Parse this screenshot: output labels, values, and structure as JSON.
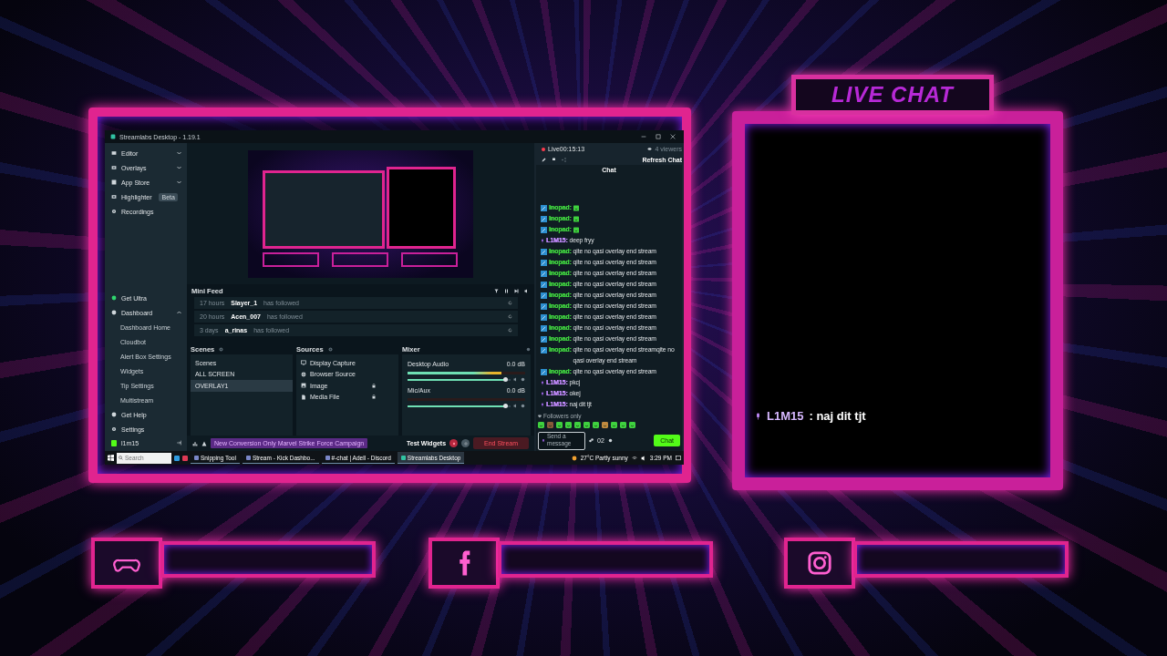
{
  "app_window": {
    "title": "Streamlabs Desktop - 1.19.1",
    "sidebar": {
      "top_items": [
        {
          "label": "Editor",
          "kind": "group",
          "expanded": false
        },
        {
          "label": "Overlays",
          "kind": "group",
          "expanded": false
        },
        {
          "label": "App Store",
          "kind": "group",
          "expanded": false
        },
        {
          "label": "Highlighter",
          "kind": "badge",
          "badge": "Beta"
        },
        {
          "label": "Recordings",
          "kind": "link"
        }
      ],
      "bottom_items": [
        {
          "label": "Get Ultra",
          "kind": "link"
        },
        {
          "label": "Dashboard",
          "kind": "group",
          "expanded": true,
          "children": [
            {
              "label": "Dashboard Home"
            },
            {
              "label": "Cloudbot"
            },
            {
              "label": "Alert Box Settings"
            },
            {
              "label": "Widgets"
            },
            {
              "label": "Tip Settings"
            },
            {
              "label": "Multistream"
            }
          ]
        },
        {
          "label": "Get Help",
          "kind": "link"
        },
        {
          "label": "Settings",
          "kind": "link"
        }
      ],
      "user": "l1m15"
    },
    "mini_feed": {
      "title": "Mini Feed",
      "events": [
        {
          "time": "17 hours",
          "user": "Slayer_1",
          "action": "has followed"
        },
        {
          "time": "20 hours",
          "user": "Acen_007",
          "action": "has followed"
        },
        {
          "time": "3 days",
          "user": "a_rinas",
          "action": "has followed"
        }
      ]
    },
    "scenes": {
      "title": "Scenes",
      "items": [
        {
          "label": "Scenes",
          "selected": false
        },
        {
          "label": "ALL SCREEN",
          "selected": false
        },
        {
          "label": "OVERLAY1",
          "selected": true
        }
      ]
    },
    "sources": {
      "title": "Sources",
      "items": [
        {
          "label": "Display Capture",
          "kind": "display",
          "locked": false
        },
        {
          "label": "Browser Source",
          "kind": "browser",
          "locked": false
        },
        {
          "label": "Image",
          "kind": "image",
          "locked": true
        },
        {
          "label": "Media File",
          "kind": "media",
          "locked": true
        }
      ]
    },
    "mixer": {
      "title": "Mixer",
      "channels": [
        {
          "name": "Desktop Audio",
          "reading": "0.0 dB",
          "meter": {
            "level": 0.8
          },
          "volume": {
            "level": 0.95
          }
        },
        {
          "name": "Mic/Aux",
          "reading": "0.0 dB",
          "volume": {
            "level": 0.95
          }
        }
      ]
    },
    "footer": {
      "notice": "New Conversion Only Marvel Strike Force Campaign",
      "test_widgets": "Test Widgets",
      "end_stream": "End Stream"
    },
    "chat_panel": {
      "status": "Live00:15:13",
      "viewers": "4 viewers",
      "refresh": "Refresh Chat",
      "title": "Chat",
      "messages": [
        {
          "user": "Inopad:",
          "bot": true,
          "kind": "emote",
          "color": "#3fd13f"
        },
        {
          "user": "Inopad:",
          "bot": true,
          "kind": "emote",
          "color": "#3fd13f"
        },
        {
          "user": "Inopad:",
          "bot": true,
          "kind": "emote",
          "color": "#3fd13f"
        },
        {
          "user": "L1M15:",
          "bot": false,
          "kind": "text",
          "color": "#c58cff",
          "text": "deep fryy"
        },
        {
          "user": "Inopad:",
          "bot": true,
          "kind": "text",
          "color": "#3fd13f",
          "text": "qite no qasi overlay end stream"
        },
        {
          "user": "Inopad:",
          "bot": true,
          "kind": "text",
          "color": "#3fd13f",
          "text": "qite no qasi overlay end stream"
        },
        {
          "user": "Inopad:",
          "bot": true,
          "kind": "text",
          "color": "#3fd13f",
          "text": "qite no qasi overlay end stream"
        },
        {
          "user": "Inopad:",
          "bot": true,
          "kind": "text",
          "color": "#3fd13f",
          "text": "qite no qasi overlay end stream"
        },
        {
          "user": "Inopad:",
          "bot": true,
          "kind": "text",
          "color": "#3fd13f",
          "text": "qite no qasi overlay end stream"
        },
        {
          "user": "Inopad:",
          "bot": true,
          "kind": "text",
          "color": "#3fd13f",
          "text": "qite no qasi overlay end stream"
        },
        {
          "user": "Inopad:",
          "bot": true,
          "kind": "text",
          "color": "#3fd13f",
          "text": "qite no qasi overlay end stream"
        },
        {
          "user": "Inopad:",
          "bot": true,
          "kind": "text",
          "color": "#3fd13f",
          "text": "qite no qasi overlay end stream"
        },
        {
          "user": "Inopad:",
          "bot": true,
          "kind": "text",
          "color": "#3fd13f",
          "text": "qite no qasi overlay end stream"
        },
        {
          "user": "Inopad:",
          "bot": true,
          "kind": "text",
          "color": "#3fd13f",
          "text": "qite no qasi overlay end streamqite no qasi overlay end stream"
        },
        {
          "user": "Inopad:",
          "bot": true,
          "kind": "text",
          "color": "#3fd13f",
          "text": "qite no qasi overlay end stream"
        },
        {
          "user": "L1M15:",
          "bot": false,
          "kind": "text",
          "color": "#c58cff",
          "text": "pkcj"
        },
        {
          "user": "L1M15:",
          "bot": false,
          "kind": "text",
          "color": "#c58cff",
          "text": "okej"
        },
        {
          "user": "L1M15:",
          "bot": false,
          "kind": "text",
          "color": "#c58cff",
          "text": "naj dit tjt"
        }
      ],
      "mode": "Followers only",
      "input": {
        "placeholder": "Send a message"
      },
      "points": "02",
      "send": "Chat"
    },
    "taskbar": {
      "search": {
        "placeholder": "Search"
      },
      "apps": [
        {
          "label": "Snipping Tool",
          "selected": false
        },
        {
          "label": "Stream - Kick Dashbo...",
          "selected": false
        },
        {
          "label": "#-chat | Adell - Discord",
          "selected": false
        },
        {
          "label": "Streamlabs Desktop",
          "selected": true
        }
      ],
      "weather": "27°C Partly sunny",
      "time": "3:29 PM"
    }
  },
  "overlay": {
    "live_chat": {
      "title": "LIVE CHAT",
      "message": {
        "user": "L1M15",
        "text": ": naj dit tjt"
      }
    },
    "social_bars": [
      {
        "kind": "controller"
      },
      {
        "kind": "letter-f"
      },
      {
        "kind": "camera"
      }
    ]
  }
}
